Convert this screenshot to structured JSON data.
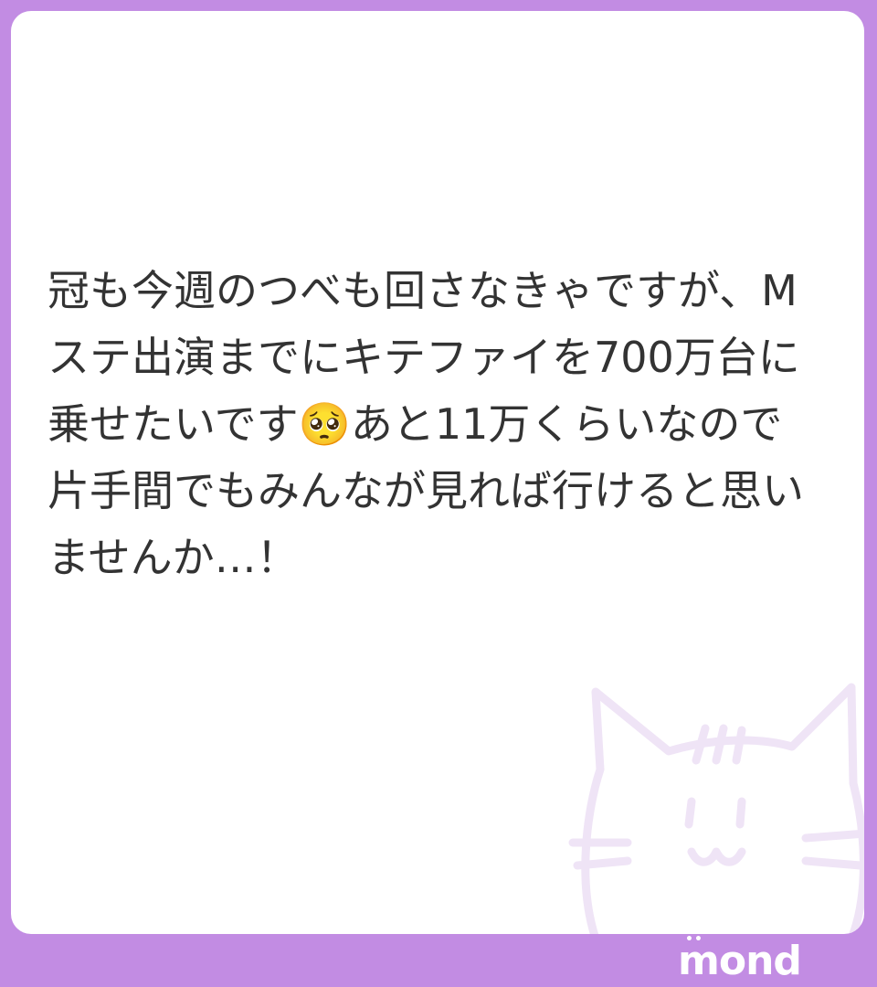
{
  "message": {
    "text": "冠も今週のつべも回さなきゃですが、Mステ出演までにキテファイを700万台に乗せたいです🥺あと11万くらいなので片手間でもみんなが見れば行けると思いませんか…！"
  },
  "brand": {
    "logo_text": "mond"
  },
  "colors": {
    "frame": "#c28ce3",
    "card": "#ffffff",
    "text": "#333333",
    "watermark": "#efe4f6"
  },
  "icons": {
    "watermark": "cat-face-icon"
  }
}
